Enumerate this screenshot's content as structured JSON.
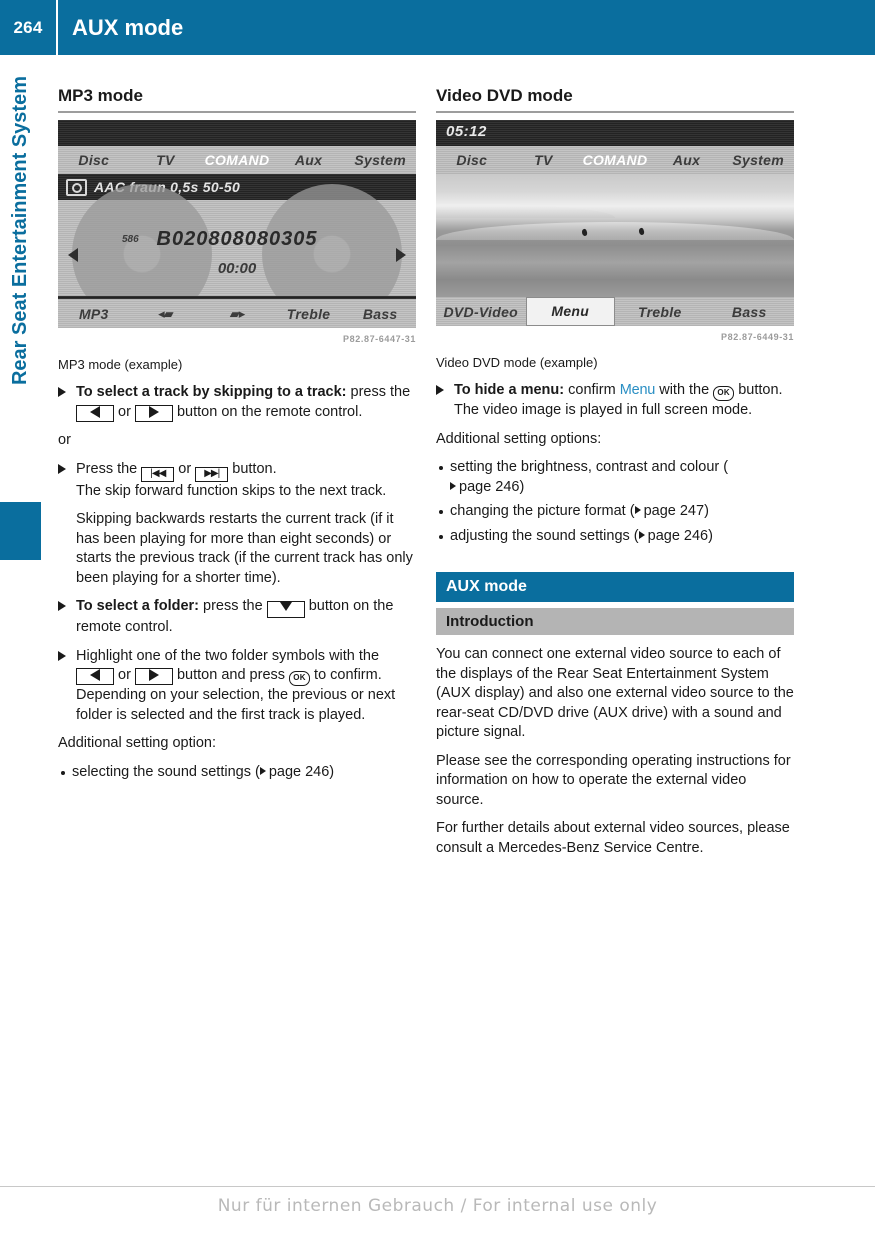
{
  "header": {
    "page_number": "264",
    "title": "AUX mode",
    "accent_color": "#0a6e9e"
  },
  "chapter": {
    "label": "Rear Seat Entertainment System",
    "color": "#0a6e9e"
  },
  "left_column": {
    "section_heading": "MP3 mode",
    "screen": {
      "clock": "",
      "menu_items": [
        "Disc",
        "TV",
        "COMAND",
        "Aux",
        "System"
      ],
      "active_menu_item": "COMAND",
      "info_text": "AAC fraun 0,5s 50-50",
      "track_number": "586",
      "track_name": "B020808080305",
      "elapsed_time": "00:00",
      "bottom_items": [
        "MP3",
        "folder-prev",
        "folder-next",
        "Treble",
        "Bass"
      ],
      "bottom_labels": [
        "MP3",
        "",
        "",
        "Treble",
        "Bass"
      ]
    },
    "figure_code": "P82.87-6447-31",
    "figure_caption": "MP3 mode (example)",
    "steps": [
      {
        "bold": "To select a track by skipping to a track:",
        "rest_a": " press the ",
        "key_a": "left-arrow-key",
        "mid": " or ",
        "key_b": "right-arrow-key",
        "rest_b": " button on the remote control."
      }
    ],
    "or_word": "or",
    "step_press": {
      "lead": "Press the ",
      "key_a": "skip-back-key",
      "mid": " or ",
      "key_b": "skip-forward-key",
      "rest": " button.",
      "line2": "The skip forward function skips to the next track.",
      "line3": "Skipping backwards restarts the current track (if it has been playing for more than eight seconds) or starts the previous track (if the current track has only been playing for a shorter time)."
    },
    "step_folder": {
      "bold": "To select a folder:",
      "rest_a": " press the ",
      "key": "down-arrow-key",
      "rest_b": " button on the remote control."
    },
    "step_highlight": {
      "lead": "Highlight one of the two folder symbols with the ",
      "key_a": "left-arrow-key",
      "mid": " or ",
      "key_b": "right-arrow-key",
      "rest": " button and press ",
      "ok_key": "OK",
      "rest2": " to confirm.",
      "line2": "Depending on your selection, the previous or next folder is selected and the first track is played."
    },
    "additional_label": "Additional setting option:",
    "bullets": [
      {
        "text_before": "selecting the sound settings (",
        "ref": "page 246",
        "text_after": ")"
      }
    ]
  },
  "right_column": {
    "section_heading": "Video DVD mode",
    "screen": {
      "clock": "05:12",
      "menu_items": [
        "Disc",
        "TV",
        "COMAND",
        "Aux",
        "System"
      ],
      "active_menu_item": "COMAND",
      "bottom_items": [
        "DVD-Video",
        "Menu",
        "Treble",
        "Bass"
      ],
      "highlighted_bottom_item": "Menu"
    },
    "figure_code": "P82.87-6449-31",
    "figure_caption": "Video DVD mode (example)",
    "step_hide": {
      "bold": "To hide a menu:",
      "rest_a": " confirm ",
      "ui_label": "Menu",
      "rest_b": " with the ",
      "ok_key": "OK",
      "rest_c": " button.",
      "line2": "The video image is played in full screen mode."
    },
    "additional_label": "Additional setting options:",
    "bullets": [
      {
        "text_before": "setting the brightness, contrast and colour (",
        "ref": "page 246",
        "text_after": ")"
      },
      {
        "text_before": "changing the picture format (",
        "ref": "page 247",
        "text_after": ")"
      },
      {
        "text_before": "adjusting the sound settings (",
        "ref": "page 246",
        "text_after": ")"
      }
    ],
    "aux_bar": "AUX mode",
    "intro_bar": "Introduction",
    "intro_paragraphs": [
      "You can connect one external video source to each of the displays of the Rear Seat Entertainment System (AUX display) and also one external video source to the rear-seat CD/DVD drive (AUX drive) with a sound and picture signal.",
      "Please see the corresponding operating instructions for information on how to operate the external video source.",
      "For further details about external video sources, please consult a Mercedes-Benz Service Centre."
    ]
  },
  "footer": {
    "watermark": "Nur für internen Gebrauch / For internal use only"
  }
}
